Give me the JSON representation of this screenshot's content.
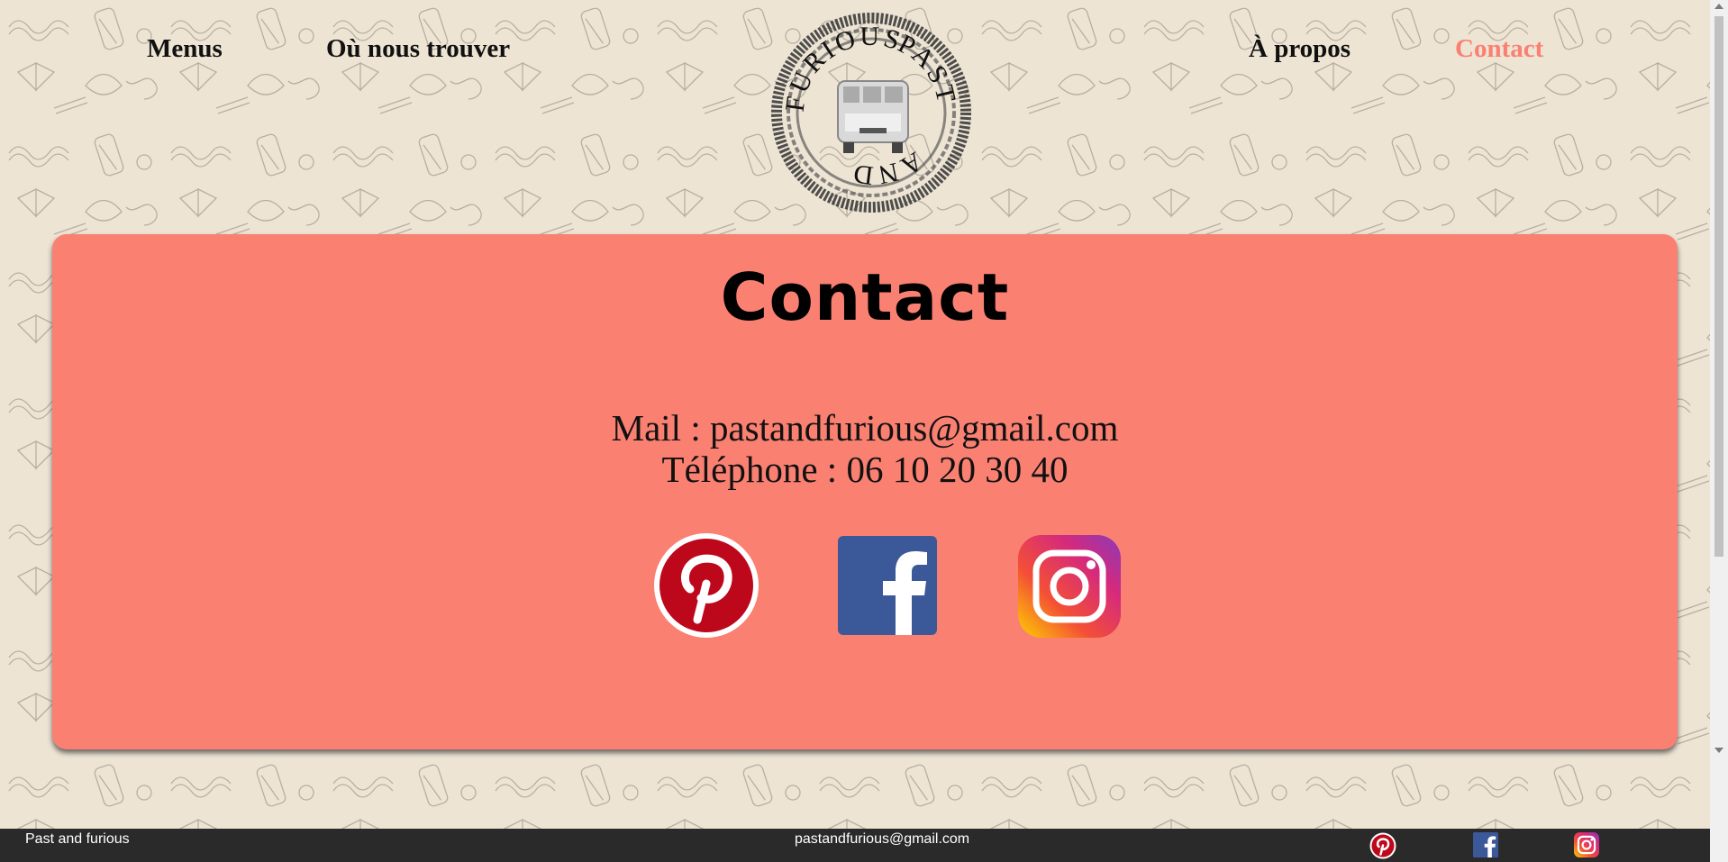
{
  "nav": {
    "menus": "Menus",
    "find_us": "Où nous trouver",
    "about": "À propos",
    "contact": "Contact",
    "logo_text_top": "PAST",
    "logo_text_bottom": "AND",
    "logo_text_left": "FURIOUS"
  },
  "contact": {
    "title": "Contact",
    "mail_line": "Mail : pastandfurious@gmail.com",
    "phone_line": "Téléphone : 06 10 20 30 40"
  },
  "socials": [
    {
      "name": "pinterest-icon",
      "color": "#bd081c"
    },
    {
      "name": "facebook-icon",
      "color": "#3b5998"
    },
    {
      "name": "instagram-icon",
      "color": "#c13584"
    }
  ],
  "footer": {
    "name": "Past and furious",
    "email": "pastandfurious@gmail.com"
  },
  "colors": {
    "background": "#ede4d4",
    "card": "#fa8072",
    "active_nav": "#fa8072",
    "footer": "#2a2a2a"
  }
}
